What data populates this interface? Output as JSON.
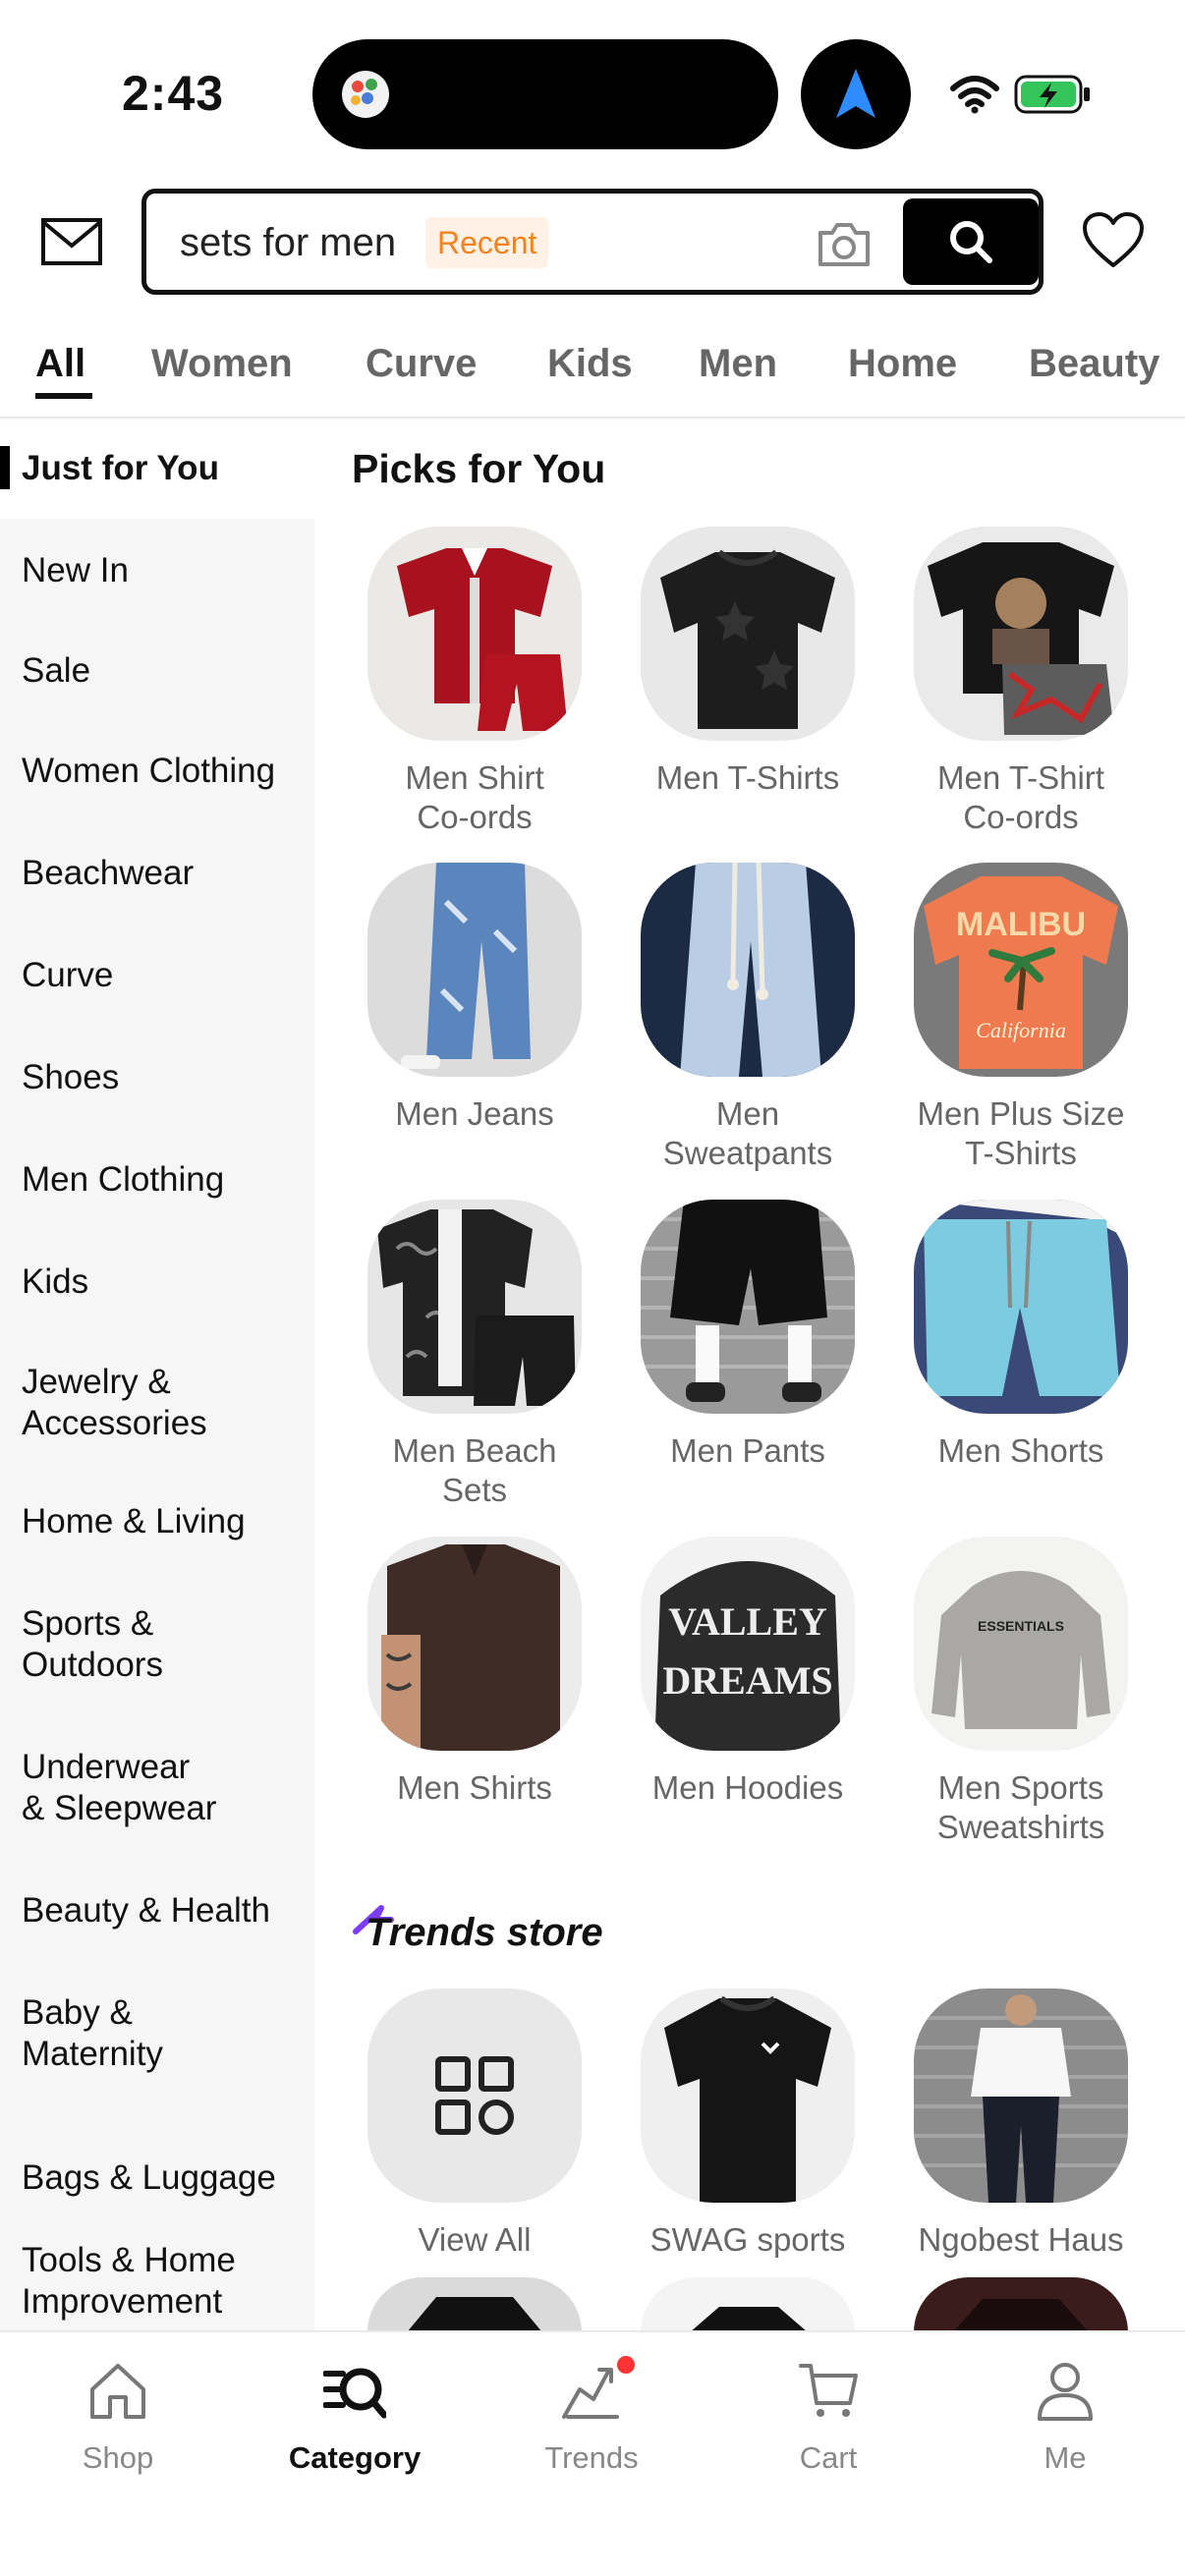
{
  "status": {
    "time": "2:43"
  },
  "search": {
    "query": "sets for men",
    "tag": "Recent"
  },
  "tabs": [
    {
      "label": "All",
      "active": true
    },
    {
      "label": "Women"
    },
    {
      "label": "Curve"
    },
    {
      "label": "Kids"
    },
    {
      "label": "Men"
    },
    {
      "label": "Home"
    },
    {
      "label": "Beauty"
    }
  ],
  "sidebar": {
    "items": [
      {
        "label": "Just for You",
        "active": true
      },
      {
        "label": "New In"
      },
      {
        "label": "Sale"
      },
      {
        "label": "Women Clothing"
      },
      {
        "label": "Beachwear"
      },
      {
        "label": "Curve"
      },
      {
        "label": "Shoes"
      },
      {
        "label": "Men Clothing"
      },
      {
        "label": "Kids"
      },
      {
        "label": "Jewelry &\nAccessories"
      },
      {
        "label": "Home & Living"
      },
      {
        "label": "Sports &\nOutdoors"
      },
      {
        "label": "Underwear\n& Sleepwear"
      },
      {
        "label": "Beauty & Health"
      },
      {
        "label": "Baby &\nMaternity"
      },
      {
        "label": "Bags & Luggage"
      },
      {
        "label": "Tools & Home\nImprovement"
      }
    ]
  },
  "picks": {
    "title": "Picks for You",
    "items": [
      {
        "label": "Men Shirt\nCo-ords",
        "icon": "red-shirt-set-image"
      },
      {
        "label": "Men T-Shirts",
        "icon": "black-tshirt-image"
      },
      {
        "label": "Men T-Shirt\nCo-ords",
        "icon": "graphic-tee-set-image"
      },
      {
        "label": "Men Jeans",
        "icon": "jeans-image"
      },
      {
        "label": "Men\nSweatpants",
        "icon": "sweatpants-image"
      },
      {
        "label": "Men Plus Size\nT-Shirts",
        "icon": "orange-tee-image"
      },
      {
        "label": "Men Beach\nSets",
        "icon": "beach-set-image"
      },
      {
        "label": "Men Pants",
        "icon": "black-pants-image"
      },
      {
        "label": "Men Shorts",
        "icon": "blue-shorts-image"
      },
      {
        "label": "Men Shirts",
        "icon": "brown-shirt-image"
      },
      {
        "label": "Men Hoodies",
        "icon": "hoodie-image"
      },
      {
        "label": "Men Sports\nSweatshirts",
        "icon": "grey-sweatshirt-image"
      }
    ]
  },
  "trends": {
    "logo_text": "Trends store",
    "items": [
      {
        "label": "View All",
        "icon": "grid-icon"
      },
      {
        "label": "SWAG sports",
        "icon": "black-tee-image"
      },
      {
        "label": "Ngobest Haus",
        "icon": "model-outfit-image"
      }
    ]
  },
  "bottom_nav": [
    {
      "label": "Shop",
      "icon": "home-icon"
    },
    {
      "label": "Category",
      "icon": "category-search-icon",
      "active": true
    },
    {
      "label": "Trends",
      "icon": "trends-icon",
      "badge": true
    },
    {
      "label": "Cart",
      "icon": "cart-icon"
    },
    {
      "label": "Me",
      "icon": "person-icon"
    }
  ],
  "colors": {
    "accent": "#f58220",
    "text": "#111111",
    "muted": "#666666",
    "sidebar_bg": "#f6f6f6",
    "badge": "#ff3333",
    "trends_purple": "#7b3cff"
  }
}
